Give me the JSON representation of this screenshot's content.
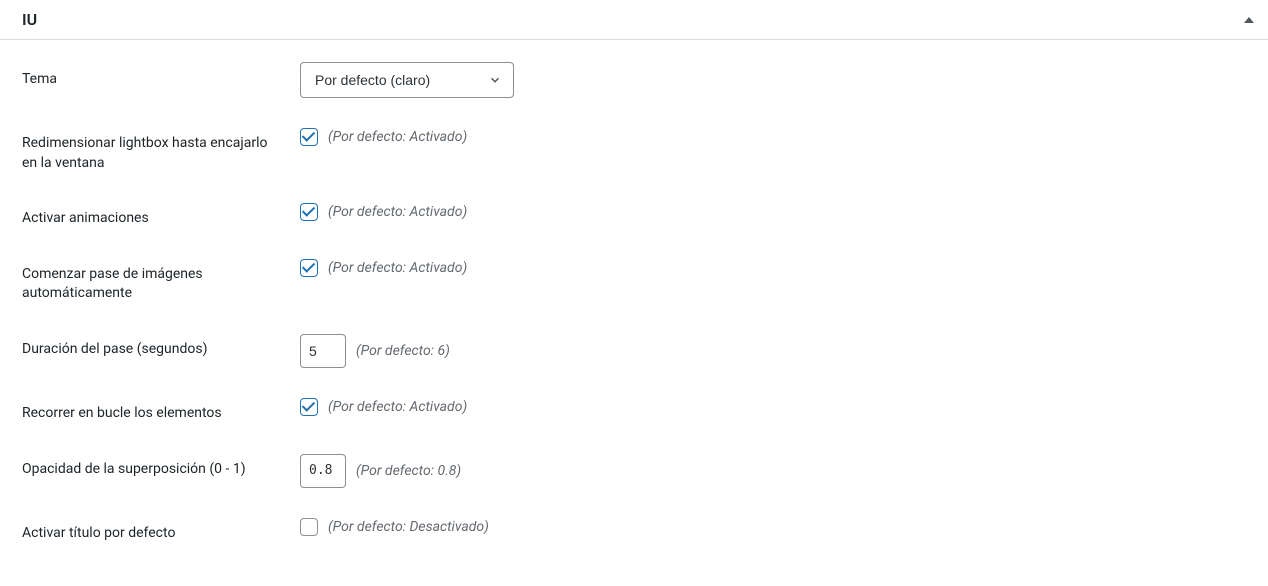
{
  "panel": {
    "title": "IU"
  },
  "fields": {
    "theme": {
      "label": "Tema",
      "value": "Por defecto (claro)"
    },
    "resize": {
      "label": "Redimensionar lightbox hasta encajarlo en la ventana",
      "checked": true,
      "hint": "(Por defecto: Activado)"
    },
    "animations": {
      "label": "Activar animaciones",
      "checked": true,
      "hint": "(Por defecto: Activado)"
    },
    "autostart": {
      "label": "Comenzar pase de imágenes automáticamente",
      "checked": true,
      "hint": "(Por defecto: Activado)"
    },
    "duration": {
      "label": "Duración del pase (segundos)",
      "value": "5",
      "hint": "(Por defecto: 6)"
    },
    "loop": {
      "label": "Recorrer en bucle los elementos",
      "checked": true,
      "hint": "(Por defecto: Activado)"
    },
    "opacity": {
      "label": "Opacidad de la superposición (0 - 1)",
      "value": "0.8",
      "hint": "(Por defecto: 0.8)"
    },
    "default_title": {
      "label": "Activar título por defecto",
      "checked": false,
      "hint": "(Por defecto: Desactivado)"
    }
  }
}
